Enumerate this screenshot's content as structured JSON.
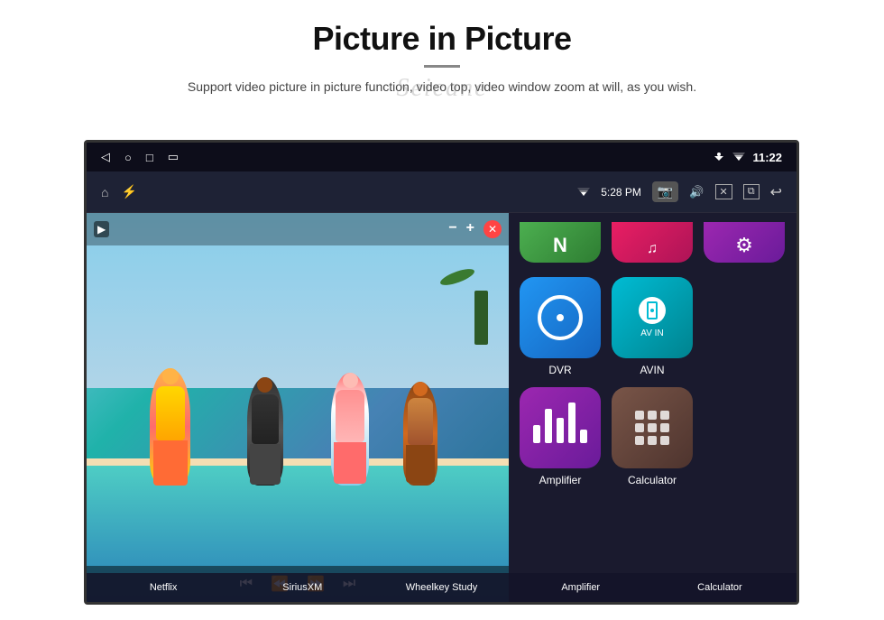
{
  "header": {
    "title": "Picture in Picture",
    "subtitle": "Support video picture in picture function, video top, video window zoom at will, as you wish.",
    "watermark": "Seicane"
  },
  "statusBar": {
    "time": "11:22",
    "topBar_time": "5:28 PM"
  },
  "apps": {
    "row1": [
      {
        "id": "netflix",
        "label": "Netflix",
        "color": "green"
      },
      {
        "id": "siriusxm",
        "label": "SiriusXM",
        "color": "pink"
      },
      {
        "id": "wheelkey",
        "label": "Wheelkey Study",
        "color": "purple"
      }
    ],
    "row2": [
      {
        "id": "dvr",
        "label": "DVR",
        "color": "blue"
      },
      {
        "id": "avin",
        "label": "AVIN",
        "color": "teal"
      }
    ],
    "row3": [
      {
        "id": "amplifier",
        "label": "Amplifier",
        "color": "purple2"
      },
      {
        "id": "calculator",
        "label": "Calculator",
        "color": "brown"
      }
    ]
  },
  "bottomLabels": [
    "Netflix",
    "SiriusXM",
    "Wheelkey Study",
    "Amplifier",
    "Calculator"
  ]
}
